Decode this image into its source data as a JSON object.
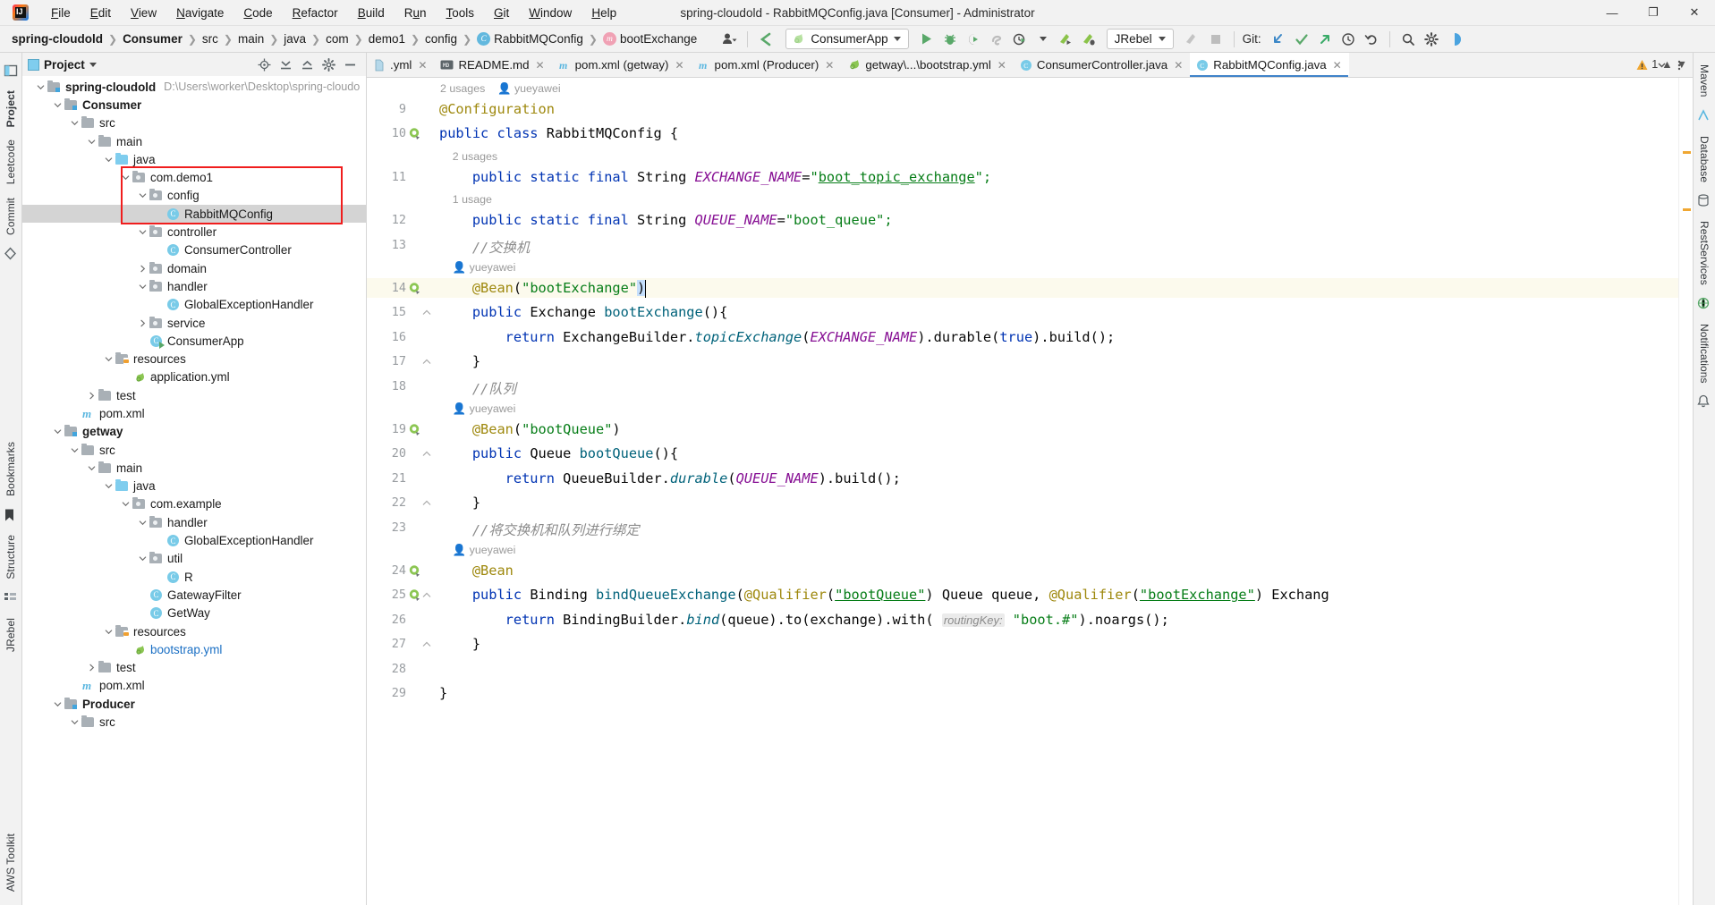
{
  "window": {
    "title": "spring-cloudold - RabbitMQConfig.java [Consumer] - Administrator",
    "app_icon": "intellij-idea-logo",
    "minimize": "—",
    "maximize": "❐",
    "close": "✕"
  },
  "menu": [
    {
      "label": "File"
    },
    {
      "label": "Edit"
    },
    {
      "label": "View"
    },
    {
      "label": "Navigate"
    },
    {
      "label": "Code"
    },
    {
      "label": "Refactor"
    },
    {
      "label": "Build"
    },
    {
      "label": "Run"
    },
    {
      "label": "Tools"
    },
    {
      "label": "Git"
    },
    {
      "label": "Window"
    },
    {
      "label": "Help"
    }
  ],
  "navbar": {
    "breadcrumbs": [
      {
        "label": "spring-cloudold",
        "bold": true,
        "icon": ""
      },
      {
        "label": "Consumer",
        "bold": true,
        "icon": ""
      },
      {
        "label": "src",
        "bold": false,
        "icon": ""
      },
      {
        "label": "main",
        "bold": false,
        "icon": ""
      },
      {
        "label": "java",
        "bold": false,
        "icon": ""
      },
      {
        "label": "com",
        "bold": false,
        "icon": ""
      },
      {
        "label": "demo1",
        "bold": false,
        "icon": ""
      },
      {
        "label": "config",
        "bold": false,
        "icon": ""
      },
      {
        "label": "RabbitMQConfig",
        "bold": false,
        "icon": "class-icon"
      },
      {
        "label": "bootExchange",
        "bold": false,
        "icon": "method-icon"
      }
    ],
    "separator": "❯",
    "run_config": "ConsumerApp",
    "jrebel": "JRebel",
    "git_label": "Git:",
    "icons": [
      "user-group-icon",
      "back-arrow-icon",
      "run-icon",
      "debug-icon",
      "run-coverage-icon",
      "profiler-icon",
      "run-with-history-icon",
      "jrebel-run-icon",
      "jrebel-debug-icon",
      "jrebel-disabled-icon",
      "stop-icon",
      "git-update-icon",
      "git-commit-icon",
      "git-push-icon",
      "git-history-icon",
      "git-rollback-icon",
      "search-icon",
      "settings-icon",
      "ide-assistant-icon"
    ]
  },
  "left_rail": {
    "items": [
      {
        "label": "Project",
        "active": true
      },
      {
        "label": "Leetcode",
        "active": false
      },
      {
        "label": "Commit",
        "active": false
      },
      {
        "label": "Bookmarks",
        "active": false
      },
      {
        "label": "Structure",
        "active": false
      },
      {
        "label": "JRebel",
        "active": false
      },
      {
        "label": "AWS Toolkit",
        "active": false
      }
    ]
  },
  "right_rail": {
    "items": [
      {
        "label": "Maven"
      },
      {
        "label": "Database"
      },
      {
        "label": "RestServices"
      },
      {
        "label": "Notifications"
      }
    ]
  },
  "project_panel": {
    "title": "Project",
    "dropdown_icon": "chevron-down-icon",
    "actions": [
      "locate-icon",
      "expand-all-icon",
      "collapse-all-icon",
      "settings-icon",
      "hide-icon"
    ],
    "tree": [
      {
        "depth": 0,
        "label": "spring-cloudold",
        "path": "D:\\Users\\worker\\Desktop\\spring-cloudo",
        "icon": "module-folder",
        "arrow": "down",
        "bold": true
      },
      {
        "depth": 1,
        "label": "Consumer",
        "icon": "module-folder",
        "arrow": "down",
        "bold": true
      },
      {
        "depth": 2,
        "label": "src",
        "icon": "folder",
        "arrow": "down"
      },
      {
        "depth": 3,
        "label": "main",
        "icon": "folder",
        "arrow": "down"
      },
      {
        "depth": 4,
        "label": "java",
        "icon": "source-folder",
        "arrow": "down"
      },
      {
        "depth": 5,
        "label": "com.demo1",
        "icon": "package",
        "arrow": "down"
      },
      {
        "depth": 6,
        "label": "config",
        "icon": "package",
        "arrow": "down"
      },
      {
        "depth": 7,
        "label": "RabbitMQConfig",
        "icon": "class",
        "arrow": "",
        "selected": true
      },
      {
        "depth": 6,
        "label": "controller",
        "icon": "package",
        "arrow": "down"
      },
      {
        "depth": 7,
        "label": "ConsumerController",
        "icon": "class",
        "arrow": ""
      },
      {
        "depth": 6,
        "label": "domain",
        "icon": "package",
        "arrow": "right"
      },
      {
        "depth": 6,
        "label": "handler",
        "icon": "package",
        "arrow": "down"
      },
      {
        "depth": 7,
        "label": "GlobalExceptionHandler",
        "icon": "class",
        "arrow": ""
      },
      {
        "depth": 6,
        "label": "service",
        "icon": "package",
        "arrow": "right"
      },
      {
        "depth": 6,
        "label": "ConsumerApp",
        "icon": "class-runnable",
        "arrow": ""
      },
      {
        "depth": 4,
        "label": "resources",
        "icon": "resource-folder",
        "arrow": "down"
      },
      {
        "depth": 5,
        "label": "application.yml",
        "icon": "spring-yaml",
        "arrow": ""
      },
      {
        "depth": 3,
        "label": "test",
        "icon": "folder",
        "arrow": "right"
      },
      {
        "depth": 2,
        "label": "pom.xml",
        "icon": "maven",
        "arrow": ""
      },
      {
        "depth": 1,
        "label": "getway",
        "icon": "module-folder",
        "arrow": "down",
        "bold": true
      },
      {
        "depth": 2,
        "label": "src",
        "icon": "folder",
        "arrow": "down"
      },
      {
        "depth": 3,
        "label": "main",
        "icon": "folder",
        "arrow": "down"
      },
      {
        "depth": 4,
        "label": "java",
        "icon": "source-folder",
        "arrow": "down"
      },
      {
        "depth": 5,
        "label": "com.example",
        "icon": "package",
        "arrow": "down"
      },
      {
        "depth": 6,
        "label": "handler",
        "icon": "package",
        "arrow": "down"
      },
      {
        "depth": 7,
        "label": "GlobalExceptionHandler",
        "icon": "class",
        "arrow": ""
      },
      {
        "depth": 6,
        "label": "util",
        "icon": "package",
        "arrow": "down"
      },
      {
        "depth": 7,
        "label": "R",
        "icon": "class",
        "arrow": ""
      },
      {
        "depth": 6,
        "label": "GatewayFilter",
        "icon": "class",
        "arrow": ""
      },
      {
        "depth": 6,
        "label": "GetWay",
        "icon": "class",
        "arrow": ""
      },
      {
        "depth": 4,
        "label": "resources",
        "icon": "resource-folder",
        "arrow": "down"
      },
      {
        "depth": 5,
        "label": "bootstrap.yml",
        "icon": "spring-yaml",
        "arrow": "",
        "highlight": true
      },
      {
        "depth": 3,
        "label": "test",
        "icon": "folder",
        "arrow": "right"
      },
      {
        "depth": 2,
        "label": "pom.xml",
        "icon": "maven",
        "arrow": ""
      },
      {
        "depth": 1,
        "label": "Producer",
        "icon": "module-folder",
        "arrow": "down",
        "bold": true
      },
      {
        "depth": 2,
        "label": "src",
        "icon": "folder",
        "arrow": "down"
      }
    ]
  },
  "editor": {
    "tabs": [
      {
        "label": ".yml",
        "icon": "yaml-icon",
        "active": false
      },
      {
        "label": "README.md",
        "icon": "markdown-icon",
        "active": false
      },
      {
        "label": "pom.xml (getway)",
        "icon": "maven-icon",
        "active": false
      },
      {
        "label": "pom.xml (Producer)",
        "icon": "maven-icon",
        "active": false
      },
      {
        "label": "getway\\...\\bootstrap.yml",
        "icon": "spring-yaml-icon",
        "active": false
      },
      {
        "label": "ConsumerController.java",
        "icon": "class-icon",
        "active": false
      },
      {
        "label": "RabbitMQConfig.java",
        "icon": "class-icon",
        "active": true
      }
    ],
    "tab_close": "✕",
    "tab_overflow_icon": "chevron-down-icon",
    "tab_options_icon": "more-options-icon",
    "warning_count": "1",
    "warning_icon": "warning-triangle-icon",
    "inspection_up_icon": "chevron-up-icon",
    "inspection_down_icon": "chevron-down-icon",
    "author": "yueyawei",
    "code_vision": {
      "class_usages": "2 usages",
      "exchange_usages": "2 usages",
      "queue_usages": "1 usage"
    },
    "lines": [
      {
        "n": "",
        "hint": "2 usages    ● yueyawei",
        "hint_only": true
      },
      {
        "n": "9",
        "gutter": "",
        "tokens": [
          {
            "t": "@Configuration",
            "c": "ann"
          }
        ]
      },
      {
        "n": "10",
        "gutter": "spring-bean-icon",
        "tokens": [
          {
            "t": "public ",
            "c": "kw"
          },
          {
            "t": "class ",
            "c": "kw"
          },
          {
            "t": "RabbitMQConfig ",
            "c": "plain"
          },
          {
            "t": "{",
            "c": "plain"
          }
        ]
      },
      {
        "n": "",
        "hint": "    2 usages",
        "hint_only": true
      },
      {
        "n": "11",
        "gutter": "",
        "tokens": [
          {
            "t": "    public ",
            "c": "kw"
          },
          {
            "t": "static ",
            "c": "kw"
          },
          {
            "t": "final ",
            "c": "kw"
          },
          {
            "t": "String ",
            "c": "plain"
          },
          {
            "t": "EXCHANGE_NAME",
            "c": "fld"
          },
          {
            "t": "=",
            "c": "plain"
          },
          {
            "t": "\"",
            "c": "str"
          },
          {
            "t": "boot_topic_exchange",
            "c": "ustr"
          },
          {
            "t": "\";",
            "c": "str"
          }
        ]
      },
      {
        "n": "",
        "hint": "    1 usage",
        "hint_only": true
      },
      {
        "n": "12",
        "gutter": "",
        "tokens": [
          {
            "t": "    public ",
            "c": "kw"
          },
          {
            "t": "static ",
            "c": "kw"
          },
          {
            "t": "final ",
            "c": "kw"
          },
          {
            "t": "String ",
            "c": "plain"
          },
          {
            "t": "QUEUE_NAME",
            "c": "fld"
          },
          {
            "t": "=",
            "c": "plain"
          },
          {
            "t": "\"boot_queue\";",
            "c": "str"
          }
        ]
      },
      {
        "n": "13",
        "gutter": "",
        "tokens": [
          {
            "t": "    //交换机",
            "c": "cmt"
          }
        ]
      },
      {
        "n": "",
        "hint": "    ● yueyawei",
        "hint_only": true
      },
      {
        "n": "14",
        "gutter": "spring-bean-icon",
        "current": true,
        "tokens": [
          {
            "t": "    @Bean",
            "c": "ann"
          },
          {
            "t": "(",
            "c": "plain"
          },
          {
            "t": "\"bootExchange\"",
            "c": "str"
          },
          {
            "t": ")",
            "c": "plain-sel"
          }
        ]
      },
      {
        "n": "15",
        "gutter": "",
        "fold": true,
        "tokens": [
          {
            "t": "    public ",
            "c": "kw"
          },
          {
            "t": "Exchange ",
            "c": "plain"
          },
          {
            "t": "bootExchange",
            "c": "mth"
          },
          {
            "t": "(){",
            "c": "plain"
          }
        ]
      },
      {
        "n": "16",
        "gutter": "",
        "tokens": [
          {
            "t": "        return ",
            "c": "kw"
          },
          {
            "t": "ExchangeBuilder.",
            "c": "plain"
          },
          {
            "t": "topicExchange",
            "c": "mth2"
          },
          {
            "t": "(",
            "c": "plain"
          },
          {
            "t": "EXCHANGE_NAME",
            "c": "fld"
          },
          {
            "t": ").durable(",
            "c": "plain"
          },
          {
            "t": "true",
            "c": "kw"
          },
          {
            "t": ").build();",
            "c": "plain"
          }
        ]
      },
      {
        "n": "17",
        "gutter": "",
        "fold": true,
        "tokens": [
          {
            "t": "    }",
            "c": "plain"
          }
        ]
      },
      {
        "n": "18",
        "gutter": "",
        "tokens": [
          {
            "t": "    //队列",
            "c": "cmt"
          }
        ]
      },
      {
        "n": "",
        "hint": "    ● yueyawei",
        "hint_only": true
      },
      {
        "n": "19",
        "gutter": "spring-bean-icon",
        "tokens": [
          {
            "t": "    @Bean",
            "c": "ann"
          },
          {
            "t": "(",
            "c": "plain"
          },
          {
            "t": "\"bootQueue\"",
            "c": "str"
          },
          {
            "t": ")",
            "c": "plain"
          }
        ]
      },
      {
        "n": "20",
        "gutter": "",
        "fold": true,
        "tokens": [
          {
            "t": "    public ",
            "c": "kw"
          },
          {
            "t": "Queue ",
            "c": "plain"
          },
          {
            "t": "bootQueue",
            "c": "mth"
          },
          {
            "t": "(){",
            "c": "plain"
          }
        ]
      },
      {
        "n": "21",
        "gutter": "",
        "tokens": [
          {
            "t": "        return ",
            "c": "kw"
          },
          {
            "t": "QueueBuilder.",
            "c": "plain"
          },
          {
            "t": "durable",
            "c": "mth2"
          },
          {
            "t": "(",
            "c": "plain"
          },
          {
            "t": "QUEUE_NAME",
            "c": "fld"
          },
          {
            "t": ").build();",
            "c": "plain"
          }
        ]
      },
      {
        "n": "22",
        "gutter": "",
        "fold": true,
        "tokens": [
          {
            "t": "    }",
            "c": "plain"
          }
        ]
      },
      {
        "n": "23",
        "gutter": "",
        "tokens": [
          {
            "t": "    //将交换机和队列进行绑定",
            "c": "cmt"
          }
        ]
      },
      {
        "n": "",
        "hint": "    ● yueyawei",
        "hint_only": true
      },
      {
        "n": "24",
        "gutter": "spring-bean-icon",
        "tokens": [
          {
            "t": "    @Bean",
            "c": "ann"
          }
        ]
      },
      {
        "n": "25",
        "gutter": "spring-bean-icon",
        "fold": true,
        "tokens": [
          {
            "t": "    public ",
            "c": "kw"
          },
          {
            "t": "Binding ",
            "c": "plain"
          },
          {
            "t": "bindQueueExchange",
            "c": "mth"
          },
          {
            "t": "(",
            "c": "plain"
          },
          {
            "t": "@Qualifier",
            "c": "ann"
          },
          {
            "t": "(",
            "c": "plain"
          },
          {
            "t": "\"bootQueue\"",
            "c": "ustr"
          },
          {
            "t": ") Queue queue, ",
            "c": "plain"
          },
          {
            "t": "@Qualifier",
            "c": "ann"
          },
          {
            "t": "(",
            "c": "plain"
          },
          {
            "t": "\"bootExchange\"",
            "c": "ustr"
          },
          {
            "t": ") Exchang",
            "c": "plain"
          }
        ]
      },
      {
        "n": "26",
        "gutter": "",
        "tokens": [
          {
            "t": "        return ",
            "c": "kw"
          },
          {
            "t": "BindingBuilder.",
            "c": "plain"
          },
          {
            "t": "bind",
            "c": "mth2"
          },
          {
            "t": "(queue).to(exchange).with( ",
            "c": "plain"
          },
          {
            "t": "routingKey:",
            "c": "phint"
          },
          {
            "t": " \"boot.#\"",
            "c": "str"
          },
          {
            "t": ").noargs();",
            "c": "plain"
          }
        ]
      },
      {
        "n": "27",
        "gutter": "",
        "fold": true,
        "tokens": [
          {
            "t": "    }",
            "c": "plain"
          }
        ]
      },
      {
        "n": "28",
        "gutter": "",
        "tokens": []
      },
      {
        "n": "29",
        "gutter": "",
        "tokens": [
          {
            "t": "}",
            "c": "plain"
          }
        ]
      }
    ]
  }
}
